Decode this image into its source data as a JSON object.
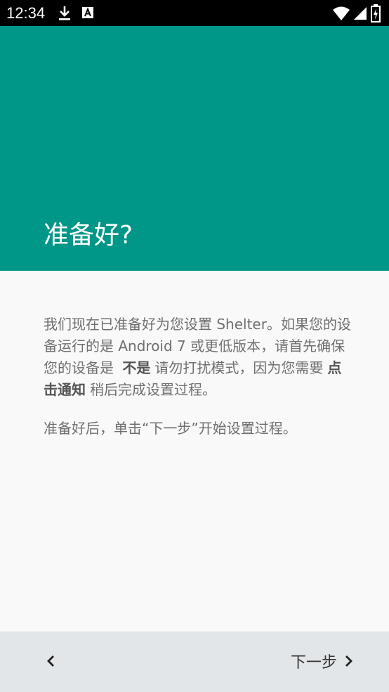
{
  "status_bar": {
    "time": "12:34",
    "icons": [
      "download-icon",
      "font-notification-icon",
      "wifi-icon",
      "signal-icon",
      "battery-charging-icon"
    ]
  },
  "header": {
    "title": "准备好?",
    "color": "#009688"
  },
  "body": {
    "p1_a": "我们现在已准备好为您设置 Shelter。如果您的设备运行的是 Android 7 或更低版本，请首先确保您的设备是",
    "p1_b1": "不是",
    "p1_c": "请勿打扰模式，因为您需要",
    "p1_b2": "点击通知",
    "p1_d": "稍后完成设置过程。",
    "p2": "准备好后，单击“下一步”开始设置过程。"
  },
  "navigation": {
    "back_icon": "chevron-left-icon",
    "next_label": "下一步",
    "next_icon": "chevron-right-icon"
  }
}
